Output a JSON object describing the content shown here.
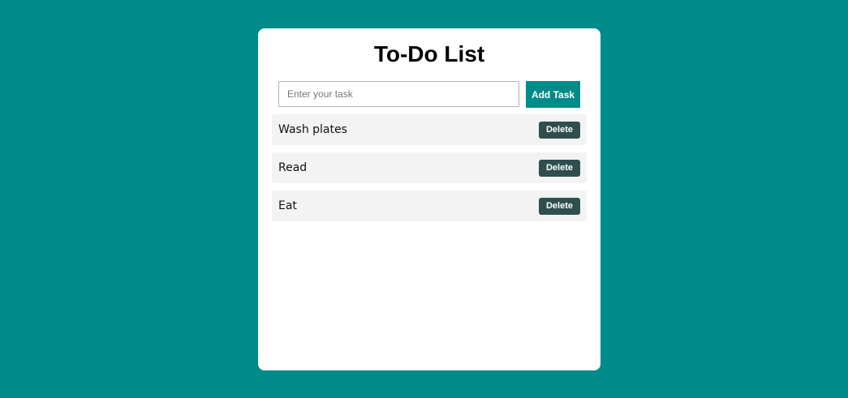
{
  "app": {
    "title": "To-Do List"
  },
  "input": {
    "placeholder": "Enter your task",
    "value": ""
  },
  "add_button": {
    "label": "Add Task"
  },
  "tasks": [
    {
      "text": "Wash plates",
      "delete_label": "Delete"
    },
    {
      "text": "Read",
      "delete_label": "Delete"
    },
    {
      "text": "Eat",
      "delete_label": "Delete"
    }
  ],
  "colors": {
    "background": "#008b8b",
    "card": "#ffffff",
    "add_button": "#008b8b",
    "delete_button": "#2f4f4f",
    "task_row": "#f3f3f3"
  }
}
